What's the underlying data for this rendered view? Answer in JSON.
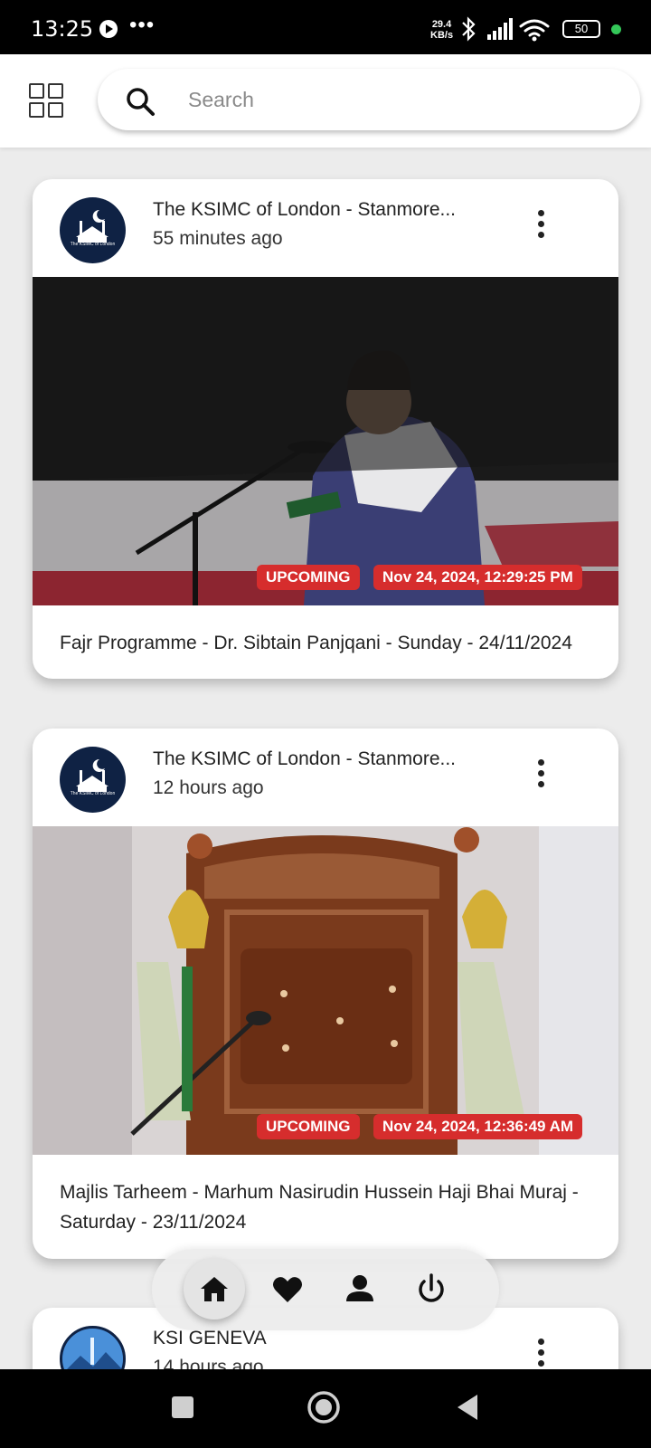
{
  "status_bar": {
    "time": "13:25",
    "speed_value": "29.4",
    "speed_unit": "KB/s",
    "battery": "50",
    "icons": [
      "play-icon",
      "more-icon",
      "bluetooth-icon",
      "signal-icon",
      "wifi-icon",
      "battery-icon"
    ]
  },
  "header": {
    "menu_icon": "grid-icon",
    "search": {
      "placeholder": "Search",
      "value": ""
    }
  },
  "posts": [
    {
      "channel": "The KSIMC of London - Stanmore...",
      "time_ago": "55 minutes ago",
      "avatar_text": "The KSIMC of London",
      "badge_status": "UPCOMING",
      "badge_date": "Nov 24, 2024, 12:29:25 PM",
      "title": "Fajr Programme - Dr. Sibtain Panjqani - Sunday - 24/11/2024"
    },
    {
      "channel": "The KSIMC of London - Stanmore...",
      "time_ago": "12 hours ago",
      "avatar_text": "The KSIMC of London",
      "badge_status": "UPCOMING",
      "badge_date": "Nov 24, 2024, 12:36:49 AM",
      "title": "Majlis Tarheem - Marhum Nasirudin Hussein Haji Bhai Muraj - Saturday - 23/11/2024"
    },
    {
      "channel": "KSI GENEVA",
      "time_ago": "14 hours ago"
    }
  ],
  "bottom_nav": {
    "items": [
      "home-icon",
      "heart-icon",
      "profile-icon",
      "power-icon"
    ],
    "active": "home-icon"
  },
  "colors": {
    "accent_red": "#d62d2d",
    "avatar_navy": "#0f2244",
    "background": "#ececec"
  }
}
